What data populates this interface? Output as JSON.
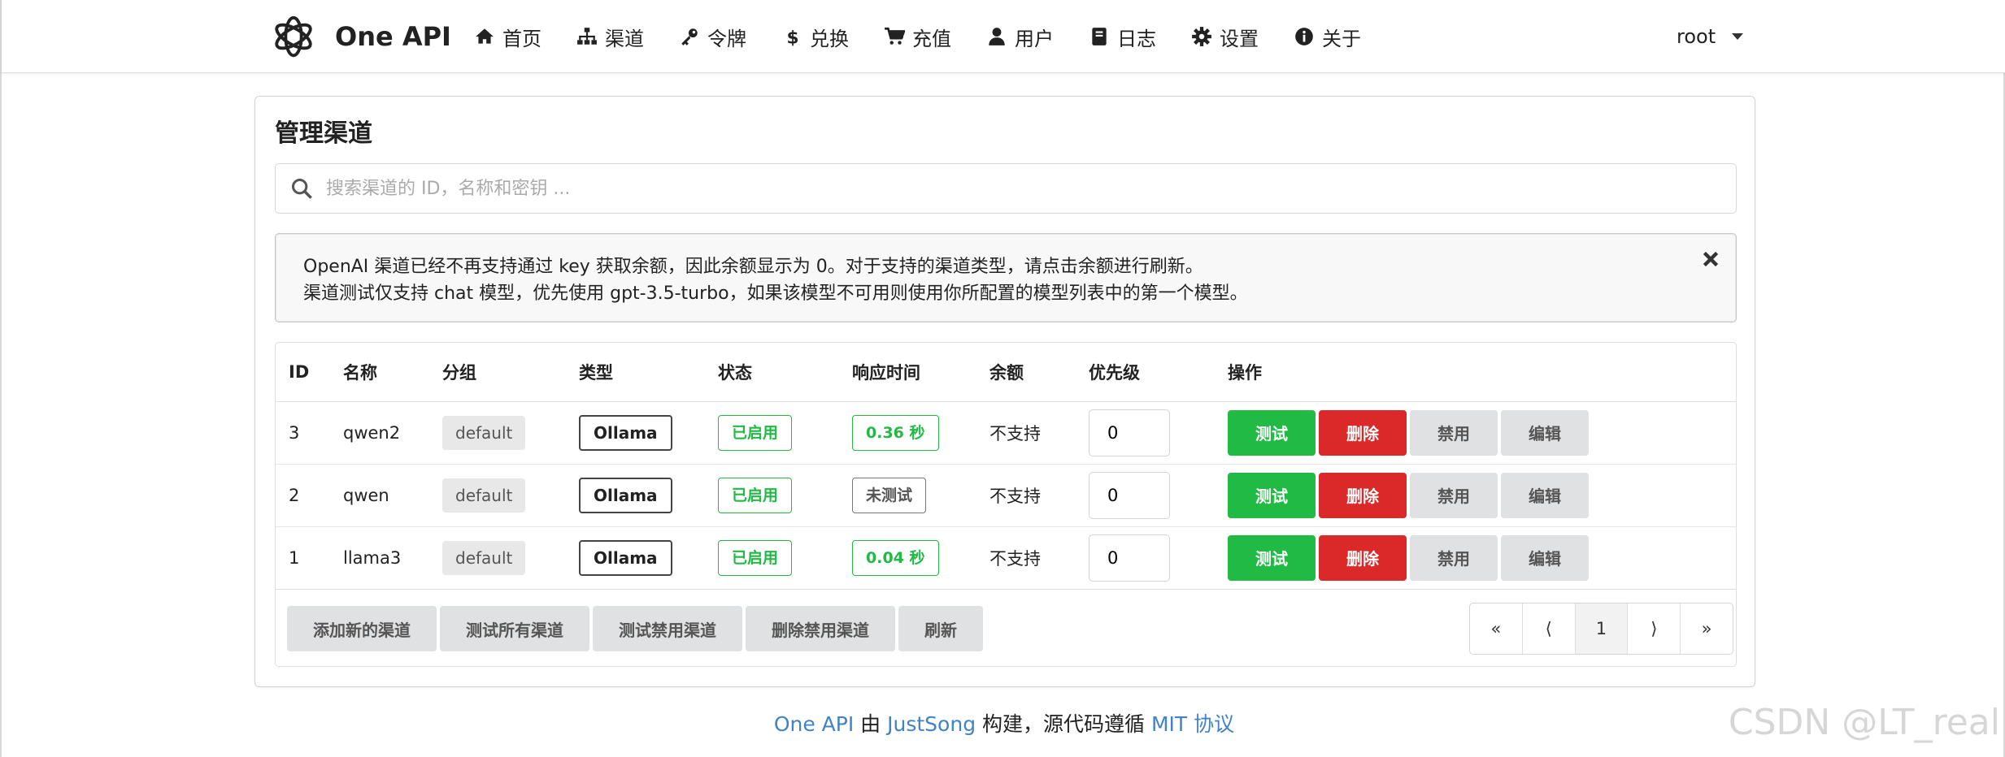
{
  "brand": {
    "name": "One API"
  },
  "menu": [
    {
      "label": "首页",
      "icon": "home-icon"
    },
    {
      "label": "渠道",
      "icon": "sitemap-icon"
    },
    {
      "label": "令牌",
      "icon": "key-icon"
    },
    {
      "label": "兑换",
      "icon": "dollar-icon"
    },
    {
      "label": "充值",
      "icon": "cart-icon"
    },
    {
      "label": "用户",
      "icon": "user-icon"
    },
    {
      "label": "日志",
      "icon": "book-icon"
    },
    {
      "label": "设置",
      "icon": "gear-icon"
    },
    {
      "label": "关于",
      "icon": "info-icon"
    }
  ],
  "user": {
    "name": "root"
  },
  "page": {
    "title": "管理渠道",
    "search_placeholder": "搜索渠道的 ID，名称和密钥 ...",
    "notice": {
      "line1": "OpenAI 渠道已经不再支持通过 key 获取余额，因此余额显示为 0。对于支持的渠道类型，请点击余额进行刷新。",
      "line2": "渠道测试仅支持 chat 模型，优先使用 gpt-3.5-turbo，如果该模型不可用则使用你所配置的模型列表中的第一个模型。"
    }
  },
  "table": {
    "headers": [
      "ID",
      "名称",
      "分组",
      "类型",
      "状态",
      "响应时间",
      "余额",
      "优先级",
      "操作"
    ],
    "rows": [
      {
        "id": "3",
        "name": "qwen2",
        "group": "default",
        "type": "Ollama",
        "status": "已启用",
        "response": "0.36 秒",
        "response_tested": true,
        "balance": "不支持",
        "priority": "0"
      },
      {
        "id": "2",
        "name": "qwen",
        "group": "default",
        "type": "Ollama",
        "status": "已启用",
        "response": "未测试",
        "response_tested": false,
        "balance": "不支持",
        "priority": "0"
      },
      {
        "id": "1",
        "name": "llama3",
        "group": "default",
        "type": "Ollama",
        "status": "已启用",
        "response": "0.04 秒",
        "response_tested": true,
        "balance": "不支持",
        "priority": "0"
      }
    ],
    "actions": {
      "test": "测试",
      "delete": "删除",
      "disable": "禁用",
      "edit": "编辑"
    }
  },
  "footer_buttons": [
    "添加新的渠道",
    "测试所有渠道",
    "测试禁用渠道",
    "删除禁用渠道",
    "刷新"
  ],
  "pagination": {
    "first": "«",
    "prev": "⟨",
    "current": "1",
    "next": "⟩",
    "last": "»"
  },
  "site_footer": {
    "part1": "One API",
    "part2": " 由 ",
    "part3": "JustSong",
    "part4": " 构建，源代码遵循 ",
    "part5": "MIT 协议"
  },
  "watermark": "CSDN @LT_real",
  "colors": {
    "green": "#21ba45",
    "red": "#db2828",
    "grey_btn": "#e0e1e2",
    "link": "#4183c4"
  }
}
